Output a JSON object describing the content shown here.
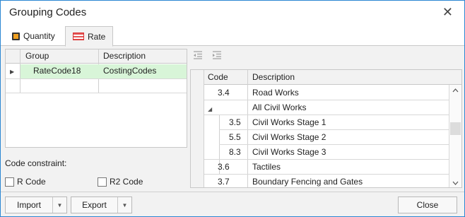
{
  "window": {
    "title": "Grouping Codes",
    "close_glyph": "✕"
  },
  "tabs": [
    {
      "label": "Quantity",
      "icon": "quantity-icon"
    },
    {
      "label": "Rate",
      "icon": "rate-icon"
    }
  ],
  "group_grid": {
    "columns": [
      "Group",
      "Description"
    ],
    "rows": [
      {
        "group": "RateCode18",
        "description": "CostingCodes",
        "selected": true
      },
      {
        "group": "",
        "description": ""
      }
    ],
    "row_indicator": "▶"
  },
  "constraints": {
    "label": "Code constraint:",
    "r_code": {
      "label": "R Code",
      "checked": false
    },
    "r2_code": {
      "label": "R2 Code",
      "checked": false
    }
  },
  "toolbar": {
    "outdent_icon": "outdent-icon",
    "indent_icon": "indent-icon"
  },
  "code_grid": {
    "columns": [
      "Code",
      "Description"
    ],
    "rows": [
      {
        "code": "3.4",
        "description": "Road Works",
        "level": 0
      },
      {
        "code": "",
        "description": "All Civil Works",
        "level": 0,
        "expanded": true
      },
      {
        "code": "3.5",
        "description": "Civil Works Stage 1",
        "level": 1
      },
      {
        "code": "5.5",
        "description": "Civil Works Stage 2",
        "level": 1
      },
      {
        "code": "8.3",
        "description": "Civil Works Stage 3",
        "level": 1
      },
      {
        "code": "3.6",
        "description": "Tactiles",
        "level": 0
      },
      {
        "code": "3.7",
        "description": "Boundary Fencing and Gates",
        "level": 0
      }
    ],
    "expander_glyph": "◢"
  },
  "buttons": {
    "import": "Import",
    "export": "Export",
    "close": "Close"
  }
}
